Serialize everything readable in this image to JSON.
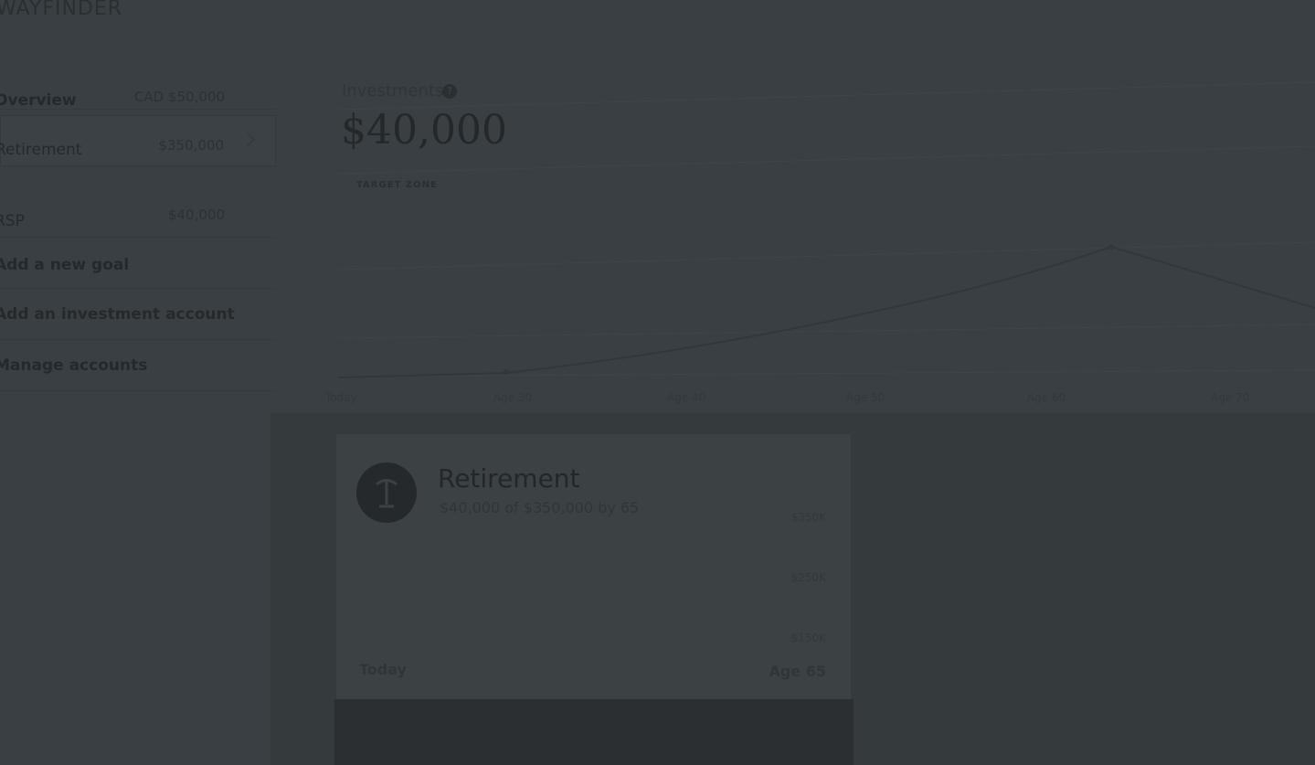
{
  "brand": {
    "logo": "WAYFINDER"
  },
  "sidebar": {
    "items": [
      {
        "label": "Overview",
        "value": "CAD $50,000",
        "bold": true
      },
      {
        "label": "Retirement",
        "value": "$350,000",
        "active": true
      },
      {
        "label": "RSP",
        "value": "$40,000"
      },
      {
        "label": "Add a new goal",
        "value": ""
      },
      {
        "label": "Add an investment account",
        "value": ""
      },
      {
        "label": "Manage accounts",
        "value": ""
      }
    ]
  },
  "investments": {
    "label": "Investments",
    "help_icon": "question-icon",
    "value": "$40,000",
    "zone_label": "TARGET ZONE"
  },
  "chart": {
    "x_labels": [
      "Today",
      "Age 30",
      "Age 40",
      "Age 50",
      "Age 60",
      "Age 70"
    ]
  },
  "goal_card": {
    "icon": "palm-tree-icon",
    "title": "Retirement",
    "subtitle": "$40,000 of $350,000 by 65",
    "y_labels": [
      "$350K",
      "$250K",
      "$150K"
    ],
    "start_label": "Today",
    "end_label": "Age 65"
  }
}
